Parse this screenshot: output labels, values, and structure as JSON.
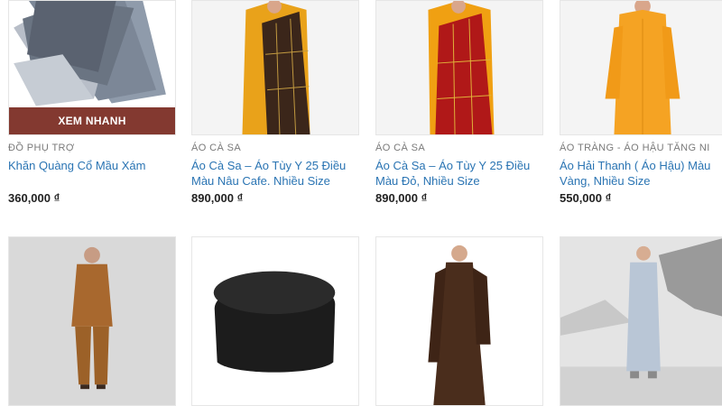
{
  "products_row1": [
    {
      "category": "ĐỒ PHỤ TRỢ",
      "title": "Khăn Quàng Cổ Mầu Xám",
      "price": "360,000 ₫",
      "quick_view": "XEM NHANH"
    },
    {
      "category": "ÁO CÀ SA",
      "title": "Áo Cà Sa – Áo Tùy Y 25 Điều Màu Nâu Cafe. Nhiều Size",
      "price": "890,000 ₫"
    },
    {
      "category": "ÁO CÀ SA",
      "title": "Áo Cà Sa – Áo Tùy Y 25 Điều Màu Đỏ, Nhiều Size",
      "price": "890,000 ₫"
    },
    {
      "category": "ÁO TRÀNG - ÁO HẬU TĂNG NI",
      "title": "Áo Hải Thanh ( Áo Hậu) Màu Vàng, Nhiều Size",
      "price": "550,000 ₫"
    }
  ],
  "colors": {
    "link": "#2a74b3",
    "category": "#7a7a7a",
    "price": "#222222",
    "quick_view_bg": "#782818"
  }
}
